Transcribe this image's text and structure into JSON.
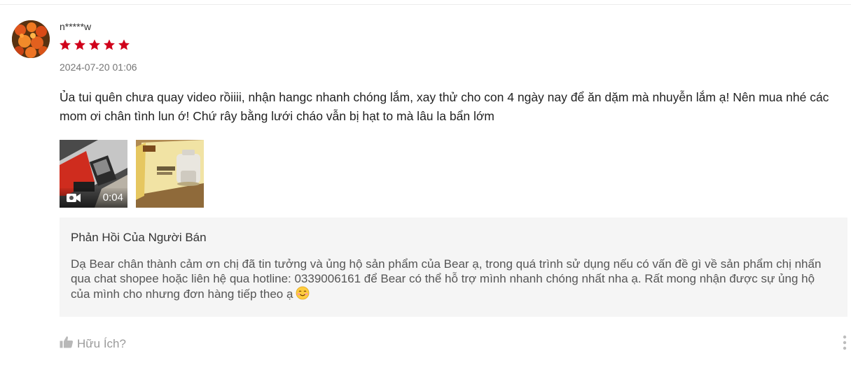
{
  "review": {
    "username": "n*****w",
    "rating": 5,
    "datetime": "2024-07-20 01:06",
    "text": "Ủa tui quên chưa quay video rồiiii, nhận hangc nhanh chóng lắm, xay thử cho con 4 ngày nay để ăn dặm mà nhuyễn lắm ạ! Nên mua nhé các mom ơi chân tình lun ớ! Chứ rây bằng lưới cháo vẫn bị hạt to mà lâu la bẩn lớm",
    "media": {
      "video_duration": "0:04"
    },
    "star_color": "#d0011b",
    "seller_reply": {
      "title": "Phản Hồi Của Người Bán",
      "text": "Dạ Bear chân thành cảm ơn chị đã tin tưởng và ủng hộ sản phẩm của Bear ạ, trong quá trình sử dụng nếu có vấn đề gì về sản phẩm chị nhấn qua chat shopee hoặc liên hệ qua hotline: 0339006161 để Bear có thể hỗ trợ mình nhanh chóng nhất nha ạ. Rất mong nhận được sự ủng hộ của mình cho nhưng đơn hàng tiếp theo ạ",
      "emoji": "smiling-face-icon"
    },
    "actions": {
      "helpful_label": "Hữu Ích?",
      "helpful_icon": "thumbs-up-icon",
      "more_icon": "more-vertical-icon"
    }
  }
}
